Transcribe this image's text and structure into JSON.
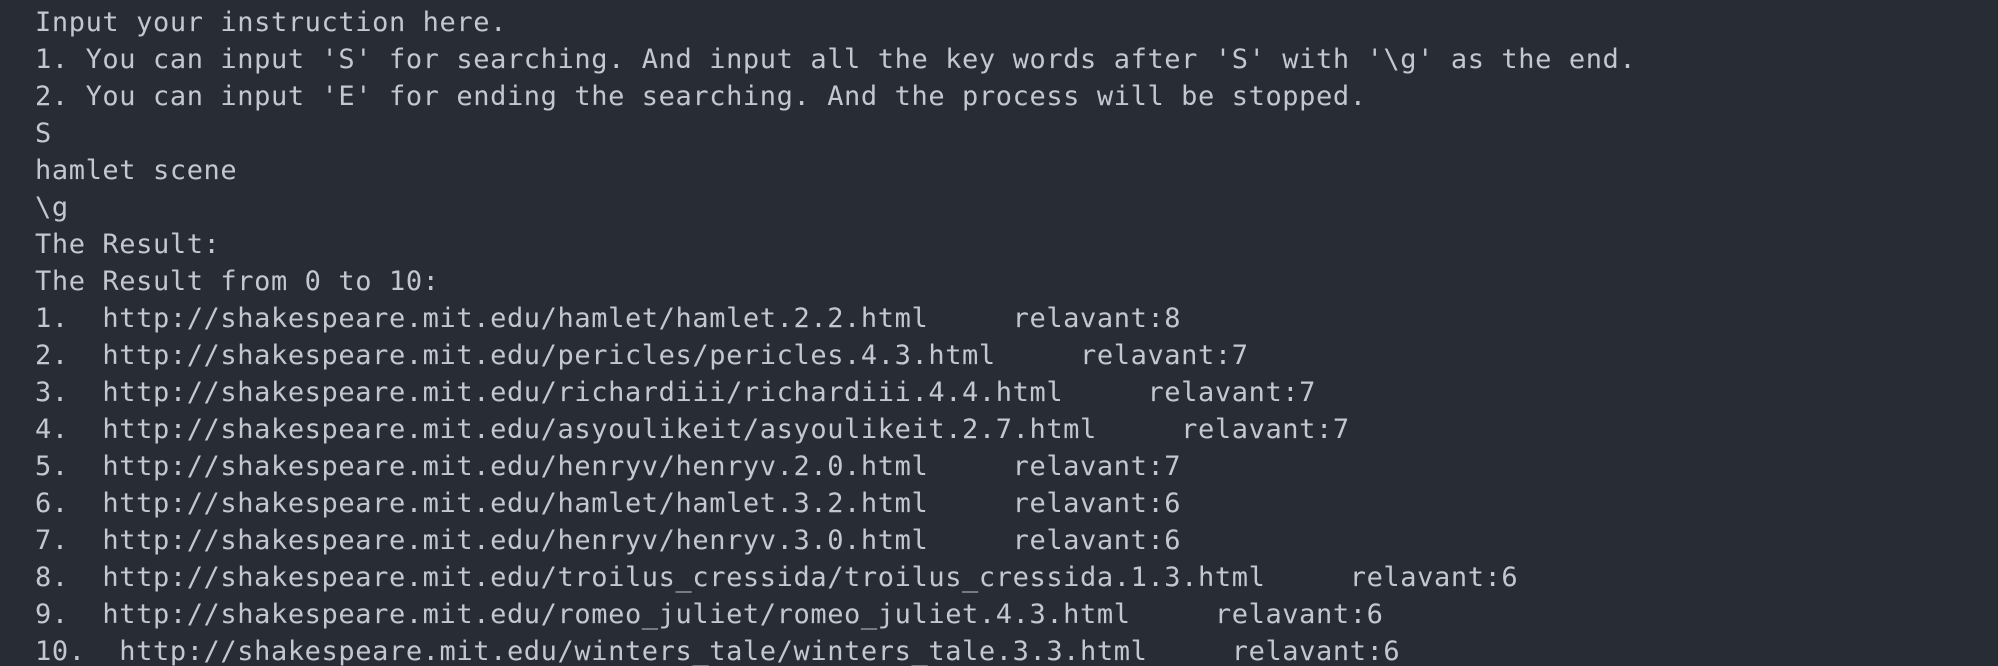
{
  "terminal": {
    "bg_color": "#282c34",
    "text_color": "#c3c8d0",
    "lines": [
      "Input your instruction here.",
      "1. You can input 'S' for searching. And input all the key words after 'S' with '\\g' as the end.",
      "2. You can input 'E' for ending the searching. And the process will be stopped.",
      "S",
      "hamlet scene",
      "\\g",
      "The Result:",
      "The Result from 0 to 10:"
    ],
    "results": [
      "1.  http://shakespeare.mit.edu/hamlet/hamlet.2.2.html     relavant:8",
      "2.  http://shakespeare.mit.edu/pericles/pericles.4.3.html     relavant:7",
      "3.  http://shakespeare.mit.edu/richardiii/richardiii.4.4.html     relavant:7",
      "4.  http://shakespeare.mit.edu/asyoulikeit/asyoulikeit.2.7.html     relavant:7",
      "5.  http://shakespeare.mit.edu/henryv/henryv.2.0.html     relavant:7",
      "6.  http://shakespeare.mit.edu/hamlet/hamlet.3.2.html     relavant:6",
      "7.  http://shakespeare.mit.edu/henryv/henryv.3.0.html     relavant:6",
      "8.  http://shakespeare.mit.edu/troilus_cressida/troilus_cressida.1.3.html     relavant:6",
      "9.  http://shakespeare.mit.edu/romeo_juliet/romeo_juliet.4.3.html     relavant:6",
      "10.  http://shakespeare.mit.edu/winters_tale/winters_tale.3.3.html     relavant:6"
    ]
  }
}
